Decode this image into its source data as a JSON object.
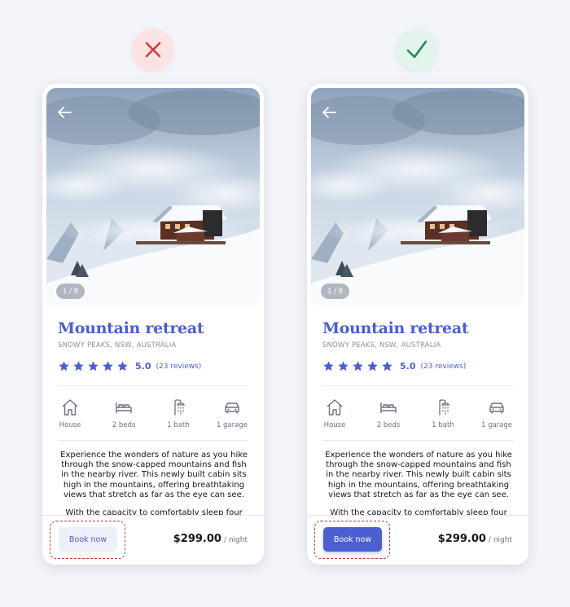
{
  "colors": {
    "accent": "#4b5fd0",
    "incorrect": "#d23b3b",
    "correct": "#1f8a5b",
    "highlight_dash": "#c0392b"
  },
  "verdicts": {
    "left": {
      "icon": "cross-icon"
    },
    "right": {
      "icon": "check-icon"
    }
  },
  "cards": [
    {
      "variant": "incorrect",
      "image_counter": "1 / 8",
      "title": "Mountain retreat",
      "location": "SNOWY PEAKS, NSW, AUSTRALIA",
      "rating": {
        "stars": 5,
        "value": "5.0",
        "reviews": "(23 reviews)"
      },
      "amenities": [
        {
          "icon": "house-icon",
          "label": "House"
        },
        {
          "icon": "bed-icon",
          "label": "2 beds"
        },
        {
          "icon": "shower-icon",
          "label": "1 bath"
        },
        {
          "icon": "car-icon",
          "label": "1 garage"
        }
      ],
      "description": [
        "Experience the wonders of nature as you hike through the snow-capped mountains and fish in the nearby river. This newly built cabin sits high in the mountains, offering breathtaking views that stretch as far as the eye can see.",
        "With the capacity to comfortably sleep four"
      ],
      "book_button": "Book now",
      "price": "$299.00",
      "price_unit": "/ night"
    },
    {
      "variant": "correct",
      "image_counter": "1 / 8",
      "title": "Mountain retreat",
      "location": "SNOWY PEAKS, NSW, AUSTRALIA",
      "rating": {
        "stars": 5,
        "value": "5.0",
        "reviews": "(23 reviews)"
      },
      "amenities": [
        {
          "icon": "house-icon",
          "label": "House"
        },
        {
          "icon": "bed-icon",
          "label": "2 beds"
        },
        {
          "icon": "shower-icon",
          "label": "1 bath"
        },
        {
          "icon": "car-icon",
          "label": "1 garage"
        }
      ],
      "description": [
        "Experience the wonders of nature as you hike through the snow-capped mountains and fish in the nearby river. This newly built cabin sits high in the mountains, offering breathtaking views that stretch as far as the eye can see.",
        "With the capacity to comfortably sleep four"
      ],
      "book_button": "Book now",
      "price": "$299.00",
      "price_unit": "/ night"
    }
  ]
}
